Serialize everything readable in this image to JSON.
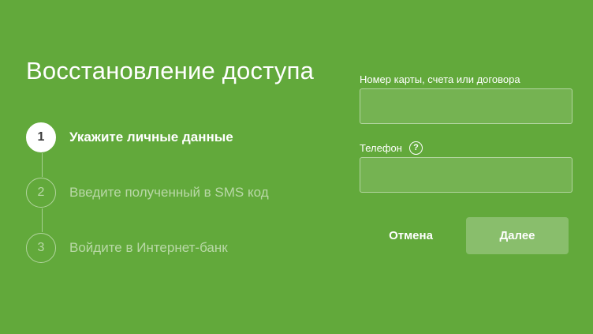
{
  "page": {
    "title": "Восстановление доступа"
  },
  "steps": [
    {
      "number": "1",
      "label": "Укажите личные данные",
      "active": true
    },
    {
      "number": "2",
      "label": "Введите полученный в SMS код",
      "active": false
    },
    {
      "number": "3",
      "label": "Войдите в Интернет-банк",
      "active": false
    }
  ],
  "form": {
    "card_label": "Номер карты, счета или договора",
    "card_value": "",
    "phone_label": "Телефон",
    "phone_value": "",
    "help_icon": "?"
  },
  "buttons": {
    "cancel_label": "Отмена",
    "next_label": "Далее"
  },
  "colors": {
    "background": "#62a93b",
    "text": "#ffffff"
  }
}
